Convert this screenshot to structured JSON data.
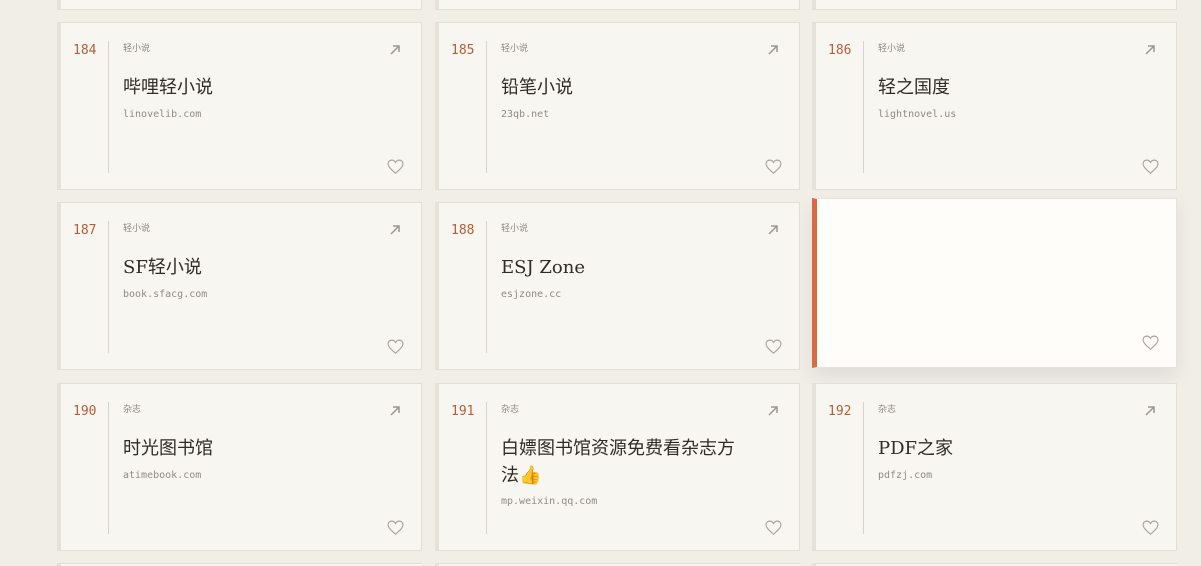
{
  "cards": [
    {
      "num": "184",
      "category": "轻小说",
      "title": "哔哩轻小说",
      "domain": "linovelib.com"
    },
    {
      "num": "185",
      "category": "轻小说",
      "title": "铅笔小说",
      "domain": "23qb.net"
    },
    {
      "num": "186",
      "category": "轻小说",
      "title": "轻之国度",
      "domain": "lightnovel.us"
    },
    {
      "num": "187",
      "category": "轻小说",
      "title": "SF轻小说",
      "domain": "book.sfacg.com"
    },
    {
      "num": "188",
      "category": "轻小说",
      "title": "ESJ Zone",
      "domain": "esjzone.cc"
    },
    {
      "num": "190",
      "category": "杂志",
      "title": "时光图书馆",
      "domain": "atimebook.com"
    },
    {
      "num": "191",
      "category": "杂志",
      "title": "白嫖图书馆资源免费看杂志方法👍",
      "domain": "mp.weixin.qq.com"
    },
    {
      "num": "192",
      "category": "杂志",
      "title": "PDF之家",
      "domain": "pdfzj.com"
    }
  ],
  "icons": {
    "open": "arrow-up-right-icon",
    "favorite": "heart-icon"
  },
  "colors": {
    "accent": "#d86b45",
    "number": "#b35e37",
    "background": "#f1eee8",
    "card": "#f8f6f1"
  }
}
